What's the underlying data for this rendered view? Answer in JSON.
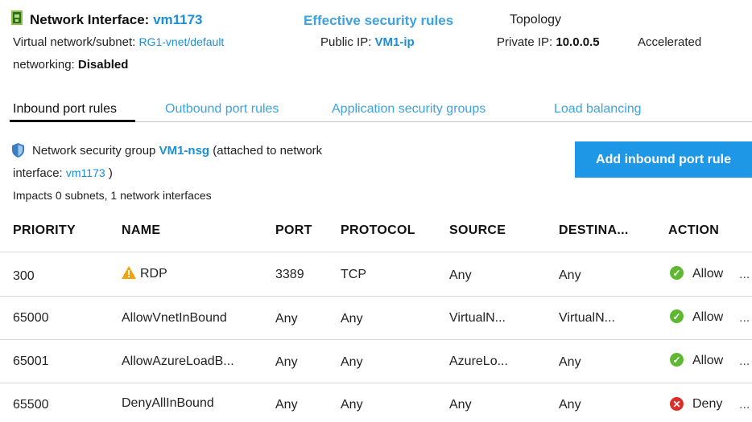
{
  "header": {
    "title_prefix": "Network Interface:",
    "title_name": "vm1173",
    "effective_rules_link": "Effective security rules",
    "topology_link": "Topology",
    "vnet_label": "Virtual network/subnet:",
    "vnet_value": "RG1-vnet/default",
    "public_ip_label": "Public IP:",
    "public_ip_value": "VM1-ip",
    "private_ip_label": "Private IP:",
    "private_ip_value": "10.0.0.5",
    "accelerated_label": "Accelerated",
    "networking_label": "networking:",
    "networking_value": "Disabled"
  },
  "tabs": [
    {
      "label": "Inbound port rules",
      "active": true
    },
    {
      "label": "Outbound port rules",
      "active": false
    },
    {
      "label": "Application security groups",
      "active": false
    },
    {
      "label": "Load balancing",
      "active": false
    }
  ],
  "nsg": {
    "prefix": "Network security group",
    "name": "VM1-nsg",
    "suffix": "(attached to network",
    "interface_label": "interface:",
    "interface_value": "vm1173",
    "interface_close": ")",
    "impacts": "Impacts 0 subnets, 1 network interfaces",
    "add_button": "Add inbound port rule"
  },
  "table": {
    "headers": [
      "PRIORITY",
      "NAME",
      "PORT",
      "PROTOCOL",
      "SOURCE",
      "DESTINA...",
      "ACTION"
    ],
    "rows": [
      {
        "priority": "300",
        "name": "RDP",
        "warning": true,
        "port": "3389",
        "protocol": "TCP",
        "source": "Any",
        "destination": "Any",
        "action": "Allow",
        "more": "..."
      },
      {
        "priority": "65000",
        "name": "AllowVnetInBound",
        "warning": false,
        "port": "Any",
        "protocol": "Any",
        "source": "VirtualN...",
        "destination": "VirtualN...",
        "action": "Allow",
        "more": "..."
      },
      {
        "priority": "65001",
        "name": "AllowAzureLoadB...",
        "warning": false,
        "port": "Any",
        "protocol": "Any",
        "source": "AzureLo...",
        "destination": "Any",
        "action": "Allow",
        "more": "..."
      },
      {
        "priority": "65500",
        "name": "DenyAllInBound",
        "warning": false,
        "port": "Any",
        "protocol": "Any",
        "source": "Any",
        "destination": "Any",
        "action": "Deny",
        "more": "..."
      }
    ]
  },
  "colors": {
    "link": "#1a8fd6",
    "button": "#1e98e6",
    "allow": "#5fb832",
    "deny": "#d9302b",
    "warning": "#f0a30a"
  },
  "icons": {
    "nic": "network-interface-icon",
    "shield": "shield-icon",
    "warning": "warning-icon",
    "allow": "check-circle-icon",
    "deny": "x-circle-icon"
  }
}
